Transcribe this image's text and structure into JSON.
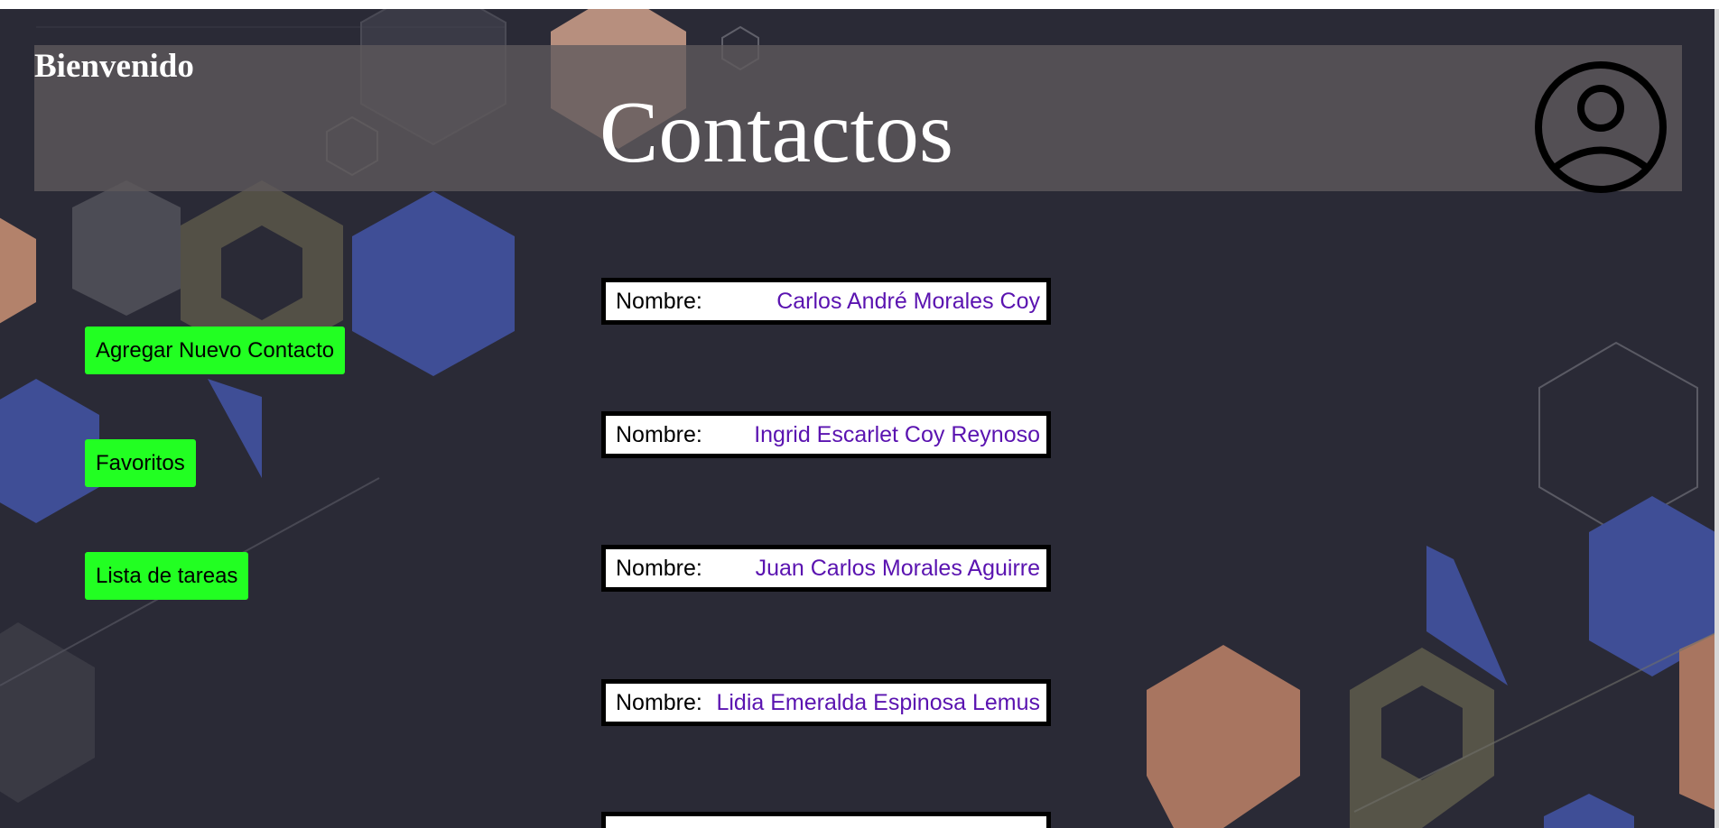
{
  "header": {
    "welcome": "Bienvenido",
    "title": "Contactos",
    "avatar_icon": "user-circle-icon"
  },
  "sidebar": {
    "buttons": [
      {
        "label": "Agregar Nuevo Contacto"
      },
      {
        "label": "Favoritos"
      },
      {
        "label": "Lista de tareas"
      }
    ],
    "button_color": "#22ff22"
  },
  "contacts": [
    {
      "label": "Nombre:",
      "name": "Carlos André Morales Coy"
    },
    {
      "label": "Nombre:",
      "name": "Ingrid Escarlet Coy Reynoso"
    },
    {
      "label": "Nombre:",
      "name": "Juan Carlos Morales Aguirre"
    },
    {
      "label": "Nombre:",
      "name": "Lidia Emeralda Espinosa Lemus"
    },
    {
      "label": "",
      "name": ""
    }
  ],
  "colors": {
    "background": "#2a2a36",
    "name_text": "#5a13b0"
  }
}
